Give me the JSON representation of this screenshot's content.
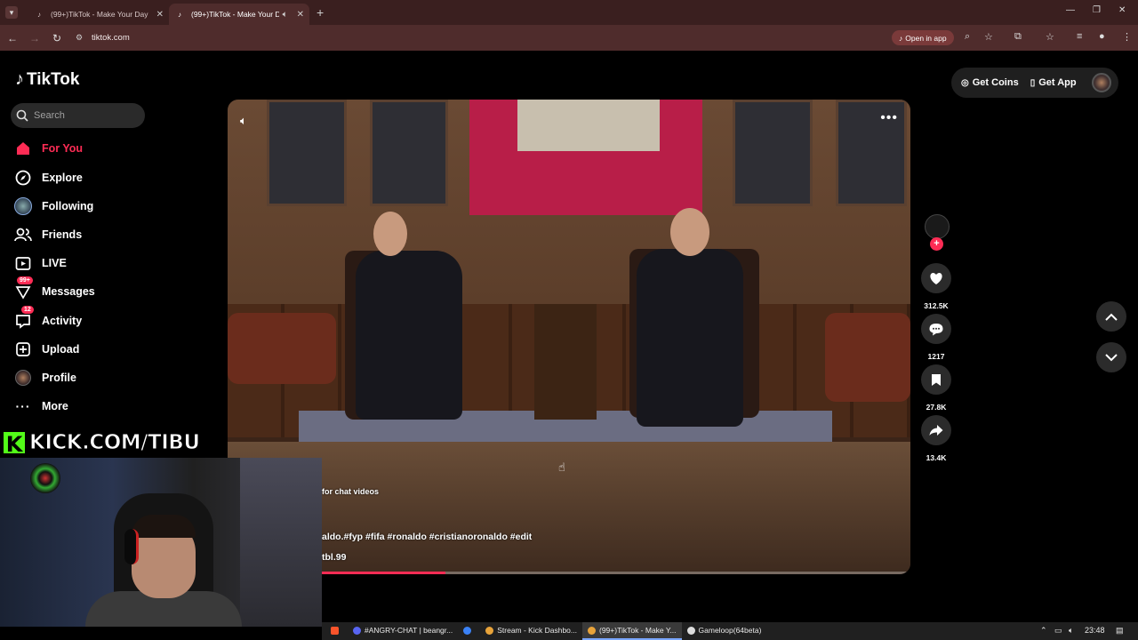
{
  "browser": {
    "tabs": [
      {
        "title": "(99+)TikTok - Make Your Day",
        "active": false
      },
      {
        "title": "(99+)TikTok - Make Your Day",
        "active": true
      }
    ],
    "url": "tiktok.com",
    "open_in_app": "Open in app"
  },
  "tiktok": {
    "logo": "TikTok",
    "search_placeholder": "Search",
    "nav": [
      {
        "label": "For You",
        "icon": "home-icon",
        "active": true
      },
      {
        "label": "Explore",
        "icon": "compass-icon"
      },
      {
        "label": "Following",
        "icon": "following-avatar-icon"
      },
      {
        "label": "Friends",
        "icon": "friends-icon"
      },
      {
        "label": "LIVE",
        "icon": "live-icon"
      },
      {
        "label": "Messages",
        "icon": "messages-icon",
        "badge": "99+"
      },
      {
        "label": "Activity",
        "icon": "activity-icon",
        "badge": "12"
      },
      {
        "label": "Upload",
        "icon": "upload-icon"
      },
      {
        "label": "Profile",
        "icon": "profile-avatar-icon"
      },
      {
        "label": "More",
        "icon": "more-dots-icon"
      }
    ],
    "get_coins": "Get Coins",
    "get_app": "Get App",
    "video": {
      "overlay_text": "for chat videos",
      "caption": "aldo.#fyp #fifa #ronaldo #cristianoronaldo #edit",
      "author": "tbl.99",
      "progress": 0.21
    },
    "actions": {
      "likes": "312.5K",
      "comments": "1217",
      "saves": "27.8K",
      "shares": "13.4K"
    }
  },
  "stream_overlay": {
    "kick_text": "KICK.COM/TIBU"
  },
  "taskbar": {
    "items": [
      {
        "label": "#ANGRY-CHAT | beangr...",
        "color": "#5865f2"
      },
      {
        "label": "",
        "color": "#3b82f6"
      },
      {
        "label": "Stream - Kick Dashbo...",
        "color": "#e8a33a"
      },
      {
        "label": "(99+)TikTok - Make Y...",
        "color": "#e8a33a",
        "active": true
      },
      {
        "label": "Gameloop(64beta)",
        "color": "#dddddd"
      }
    ],
    "time": "23:48"
  },
  "colors": {
    "accent": "#fe2c55",
    "kick_green": "#53fc18",
    "browser_frame": "#4f2c2c"
  }
}
